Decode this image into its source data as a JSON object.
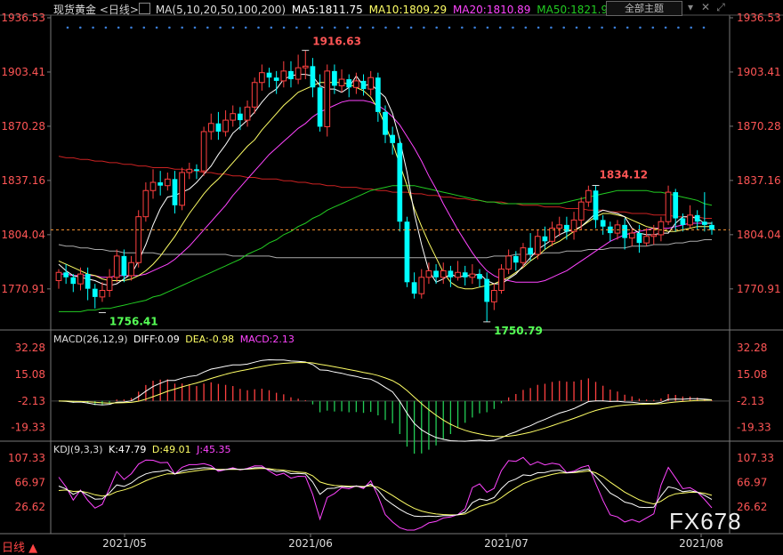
{
  "header": {
    "symbol": "现货黄金",
    "period": "<日线>",
    "ma_params": "MA(5,10,20,50,100,200)",
    "ma5": "MA5:1811.75",
    "ma10": "MA10:1809.29",
    "ma20": "MA20:1810.89",
    "ma50": "MA50:1821.9",
    "main_indicator_button": "全部主题",
    "dropdown_icon": "chevron-down-icon",
    "close_icon": "close-icon",
    "expand_icon": "expand-icon"
  },
  "colors": {
    "up": "#ff4040",
    "down": "#00ffff",
    "ma5": "#ffffff",
    "ma10": "#ffff66",
    "ma20": "#ff44ff",
    "ma50": "#22cc22",
    "ma100": "#aaaaaa",
    "ma200": "#cc2222"
  },
  "chart_data": [
    {
      "type": "candlestick",
      "title": "现货黄金 日线",
      "y_ticks": [
        "1936.53",
        "1903.41",
        "1870.28",
        "1837.16",
        "1804.04",
        "1770.91"
      ],
      "ylim": [
        1748,
        1936.53
      ],
      "x_labels": [
        "2021/05",
        "2021/06",
        "2021/07",
        "2021/08"
      ],
      "annotations": [
        {
          "label": "1916.63",
          "value": 1916.63,
          "kind": "high"
        },
        {
          "label": "1756.41",
          "value": 1756.41,
          "kind": "low"
        },
        {
          "label": "1750.79",
          "value": 1750.79,
          "kind": "low"
        },
        {
          "label": "1834.12",
          "value": 1834.12,
          "kind": "high"
        }
      ],
      "last_price": 1807,
      "candles": [
        [
          1776,
          1781,
          1771,
          1783
        ],
        [
          1781,
          1778,
          1774,
          1786
        ],
        [
          1778,
          1774,
          1769,
          1780
        ],
        [
          1774,
          1780,
          1770,
          1784
        ],
        [
          1780,
          1771,
          1764,
          1784
        ],
        [
          1771,
          1766,
          1759,
          1774
        ],
        [
          1766,
          1770,
          1763,
          1775
        ],
        [
          1770,
          1778,
          1766,
          1783
        ],
        [
          1778,
          1791,
          1775,
          1795
        ],
        [
          1791,
          1779,
          1775,
          1795
        ],
        [
          1779,
          1787,
          1776,
          1791
        ],
        [
          1787,
          1815,
          1784,
          1819
        ],
        [
          1815,
          1831,
          1812,
          1836
        ],
        [
          1831,
          1836,
          1826,
          1844
        ],
        [
          1836,
          1834,
          1828,
          1843
        ],
        [
          1834,
          1838,
          1831,
          1842
        ],
        [
          1838,
          1822,
          1817,
          1843
        ],
        [
          1822,
          1842,
          1819,
          1845
        ],
        [
          1842,
          1844,
          1838,
          1848
        ],
        [
          1844,
          1843,
          1838,
          1847
        ],
        [
          1843,
          1867,
          1840,
          1870
        ],
        [
          1867,
          1872,
          1862,
          1878
        ],
        [
          1872,
          1867,
          1862,
          1879
        ],
        [
          1867,
          1874,
          1864,
          1880
        ],
        [
          1874,
          1878,
          1870,
          1883
        ],
        [
          1878,
          1874,
          1868,
          1882
        ],
        [
          1874,
          1882,
          1870,
          1886
        ],
        [
          1882,
          1897,
          1878,
          1900
        ],
        [
          1897,
          1903,
          1892,
          1908
        ],
        [
          1903,
          1900,
          1894,
          1906
        ],
        [
          1900,
          1898,
          1890,
          1904
        ],
        [
          1898,
          1904,
          1894,
          1910
        ],
        [
          1904,
          1899,
          1894,
          1910
        ],
        [
          1899,
          1906,
          1896,
          1914
        ],
        [
          1906,
          1907,
          1899,
          1916.6
        ],
        [
          1907,
          1894,
          1888,
          1912
        ],
        [
          1894,
          1870,
          1867,
          1902
        ],
        [
          1870,
          1904,
          1864,
          1908
        ],
        [
          1904,
          1895,
          1890,
          1908
        ],
        [
          1895,
          1899,
          1891,
          1905
        ],
        [
          1899,
          1894,
          1888,
          1902
        ],
        [
          1894,
          1898,
          1890,
          1903
        ],
        [
          1898,
          1893,
          1889,
          1902
        ],
        [
          1893,
          1900,
          1889,
          1904
        ],
        [
          1900,
          1879,
          1873,
          1903
        ],
        [
          1879,
          1865,
          1860,
          1883
        ],
        [
          1865,
          1860,
          1853,
          1870
        ],
        [
          1860,
          1812,
          1806,
          1863
        ],
        [
          1812,
          1775,
          1772,
          1815
        ],
        [
          1775,
          1768,
          1765,
          1781
        ],
        [
          1768,
          1778,
          1765,
          1783
        ],
        [
          1778,
          1782,
          1774,
          1787
        ],
        [
          1782,
          1778,
          1774,
          1786
        ],
        [
          1778,
          1782,
          1774,
          1787
        ],
        [
          1782,
          1778,
          1772,
          1785
        ],
        [
          1778,
          1781,
          1776,
          1788
        ],
        [
          1781,
          1778,
          1773,
          1785
        ],
        [
          1778,
          1780,
          1774,
          1786
        ],
        [
          1780,
          1777,
          1772,
          1783
        ],
        [
          1777,
          1763,
          1751,
          1781
        ],
        [
          1763,
          1770,
          1758,
          1774
        ],
        [
          1770,
          1783,
          1768,
          1786
        ],
        [
          1783,
          1791,
          1780,
          1795
        ],
        [
          1791,
          1787,
          1782,
          1794
        ],
        [
          1787,
          1796,
          1784,
          1799
        ],
        [
          1796,
          1792,
          1788,
          1805
        ],
        [
          1792,
          1803,
          1789,
          1807
        ],
        [
          1803,
          1800,
          1795,
          1809
        ],
        [
          1800,
          1808,
          1797,
          1812
        ],
        [
          1808,
          1810,
          1803,
          1815
        ],
        [
          1810,
          1806,
          1801,
          1815
        ],
        [
          1806,
          1813,
          1801,
          1818
        ],
        [
          1813,
          1824,
          1807,
          1827
        ],
        [
          1824,
          1831,
          1821,
          1834
        ],
        [
          1831,
          1813,
          1808,
          1834
        ],
        [
          1813,
          1809,
          1804,
          1816
        ],
        [
          1809,
          1805,
          1800,
          1812
        ],
        [
          1805,
          1810,
          1801,
          1813
        ],
        [
          1810,
          1802,
          1795,
          1814
        ],
        [
          1802,
          1805,
          1797,
          1808
        ],
        [
          1805,
          1799,
          1793,
          1810
        ],
        [
          1799,
          1803,
          1797,
          1808
        ],
        [
          1803,
          1804,
          1798,
          1810
        ],
        [
          1804,
          1812,
          1800,
          1815
        ],
        [
          1812,
          1830,
          1810,
          1834
        ],
        [
          1830,
          1814,
          1806,
          1832
        ],
        [
          1814,
          1810,
          1806,
          1817
        ],
        [
          1810,
          1816,
          1808,
          1822
        ],
        [
          1816,
          1812,
          1807,
          1819
        ],
        [
          1812,
          1810,
          1806,
          1830
        ],
        [
          1810,
          1807,
          1804,
          1812
        ]
      ],
      "ma": {
        "ma5": [
          1786,
          1782,
          1779,
          1778,
          1777,
          1776,
          1774,
          1773,
          1774,
          1777,
          1780,
          1788,
          1798,
          1810,
          1820,
          1827,
          1828,
          1830,
          1832,
          1836,
          1841,
          1846,
          1853,
          1859,
          1866,
          1870,
          1874,
          1879,
          1885,
          1890,
          1893,
          1899,
          1901,
          1902,
          1902,
          1901,
          1895,
          1893,
          1893,
          1891,
          1894,
          1901,
          1895,
          1896,
          1892,
          1888,
          1878,
          1862,
          1842,
          1817,
          1798,
          1782,
          1775,
          1777,
          1780,
          1778,
          1779,
          1779,
          1780,
          1776,
          1774,
          1774,
          1777,
          1780,
          1785,
          1790,
          1795,
          1798,
          1801,
          1804,
          1806,
          1807,
          1809,
          1813,
          1817,
          1819,
          1818,
          1817,
          1815,
          1808,
          1805,
          1804,
          1804,
          1805,
          1805,
          1811,
          1815,
          1815,
          1814,
          1811,
          1811
        ],
        "ma10": [
          1788,
          1786,
          1784,
          1782,
          1780,
          1779,
          1777,
          1776,
          1776,
          1776,
          1777,
          1779,
          1782,
          1786,
          1791,
          1797,
          1803,
          1810,
          1817,
          1823,
          1829,
          1834,
          1838,
          1843,
          1848,
          1853,
          1858,
          1862,
          1868,
          1873,
          1878,
          1883,
          1887,
          1891,
          1893,
          1895,
          1897,
          1897,
          1897,
          1897,
          1896,
          1894,
          1892,
          1888,
          1881,
          1871,
          1860,
          1847,
          1834,
          1820,
          1809,
          1799,
          1790,
          1781,
          1775,
          1772,
          1771,
          1771,
          1772,
          1773,
          1774,
          1776,
          1778,
          1781,
          1784,
          1788,
          1791,
          1795,
          1798,
          1800,
          1803,
          1806,
          1809,
          1812,
          1815,
          1817,
          1817,
          1816,
          1815,
          1813,
          1811,
          1809,
          1808,
          1807,
          1806,
          1806,
          1807,
          1808,
          1809,
          1809,
          1809
        ],
        "ma20": [
          1780,
          1780,
          1779,
          1779,
          1779,
          1779,
          1778,
          1778,
          1779,
          1779,
          1779,
          1779,
          1780,
          1782,
          1784,
          1786,
          1789,
          1793,
          1797,
          1802,
          1807,
          1812,
          1817,
          1822,
          1828,
          1833,
          1838,
          1843,
          1848,
          1853,
          1857,
          1861,
          1865,
          1869,
          1872,
          1876,
          1879,
          1881,
          1883,
          1885,
          1886,
          1886,
          1886,
          1885,
          1883,
          1880,
          1876,
          1871,
          1864,
          1857,
          1849,
          1840,
          1832,
          1823,
          1815,
          1807,
          1800,
          1793,
          1787,
          1782,
          1779,
          1777,
          1776,
          1775,
          1775,
          1775,
          1775,
          1776,
          1778,
          1780,
          1782,
          1785,
          1788,
          1791,
          1794,
          1797,
          1800,
          1802,
          1804,
          1805,
          1806,
          1807,
          1808,
          1808,
          1808,
          1809,
          1810,
          1811,
          1811,
          1811,
          1811
        ],
        "ma50": [
          1757,
          1757,
          1757,
          1757,
          1758,
          1758,
          1759,
          1759,
          1760,
          1761,
          1762,
          1763,
          1764,
          1766,
          1767,
          1769,
          1771,
          1773,
          1775,
          1777,
          1779,
          1781,
          1783,
          1785,
          1787,
          1789,
          1792,
          1794,
          1796,
          1799,
          1801,
          1804,
          1806,
          1809,
          1811,
          1814,
          1816,
          1819,
          1821,
          1823,
          1825,
          1827,
          1829,
          1831,
          1832,
          1833,
          1834,
          1834,
          1834,
          1834,
          1833,
          1832,
          1831,
          1830,
          1829,
          1828,
          1827,
          1826,
          1825,
          1824,
          1824,
          1823,
          1823,
          1823,
          1823,
          1823,
          1823,
          1823,
          1823,
          1823,
          1824,
          1825,
          1826,
          1827,
          1828,
          1829,
          1830,
          1831,
          1831,
          1831,
          1831,
          1831,
          1830,
          1830,
          1829,
          1828,
          1827,
          1826,
          1825,
          1823,
          1822
        ],
        "ma100": [
          1798,
          1797,
          1797,
          1796,
          1796,
          1795,
          1795,
          1794,
          1794,
          1793,
          1793,
          1793,
          1793,
          1793,
          1792,
          1792,
          1792,
          1792,
          1792,
          1792,
          1792,
          1792,
          1792,
          1792,
          1791,
          1791,
          1791,
          1791,
          1791,
          1791,
          1790,
          1790,
          1790,
          1790,
          1790,
          1790,
          1790,
          1790,
          1790,
          1790,
          1790,
          1790,
          1790,
          1790,
          1790,
          1790,
          1790,
          1790,
          1790,
          1790,
          1790,
          1790,
          1790,
          1790,
          1790,
          1790,
          1790,
          1790,
          1790,
          1790,
          1791,
          1791,
          1791,
          1792,
          1792,
          1792,
          1792,
          1793,
          1793,
          1793,
          1794,
          1794,
          1794,
          1795,
          1795,
          1795,
          1796,
          1796,
          1796,
          1797,
          1797,
          1797,
          1798,
          1798,
          1798,
          1799,
          1799,
          1800,
          1800,
          1801,
          1801
        ],
        "ma200": [
          1852,
          1851,
          1851,
          1850,
          1850,
          1849,
          1849,
          1848,
          1848,
          1847,
          1847,
          1846,
          1846,
          1845,
          1845,
          1845,
          1844,
          1844,
          1843,
          1843,
          1842,
          1842,
          1841,
          1841,
          1840,
          1840,
          1839,
          1839,
          1838,
          1838,
          1838,
          1837,
          1837,
          1836,
          1836,
          1835,
          1835,
          1834,
          1834,
          1833,
          1833,
          1833,
          1832,
          1832,
          1831,
          1831,
          1830,
          1830,
          1830,
          1829,
          1829,
          1828,
          1828,
          1827,
          1827,
          1826,
          1826,
          1825,
          1825,
          1824,
          1824,
          1824,
          1823,
          1823,
          1822,
          1822,
          1822,
          1821,
          1821,
          1821,
          1820,
          1820,
          1820,
          1819,
          1819,
          1819,
          1818,
          1818,
          1818,
          1817,
          1817,
          1817,
          1816,
          1816,
          1816,
          1815,
          1815,
          1815,
          1815,
          1814,
          1814
        ]
      }
    },
    {
      "type": "bar+line",
      "title": "MACD(26,12,9)",
      "legend": [
        "DIFF:0.09",
        "DEA:-0.98",
        "MACD:2.13"
      ],
      "y_ticks": [
        "32.28",
        "15.08",
        "-2.13",
        "-19.33"
      ],
      "ylim": [
        -27,
        37
      ],
      "zero": -2.13
    },
    {
      "type": "line",
      "title": "KDJ(9,3,3)",
      "legend": [
        "K:47.79",
        "D:49.01",
        "J:45.35"
      ],
      "y_ticks": [
        "107.33",
        "66.97",
        "26.62"
      ],
      "ylim": [
        -15,
        115
      ]
    }
  ],
  "footer": {
    "period_tab": "日线 ▲",
    "watermark": "FX678"
  }
}
